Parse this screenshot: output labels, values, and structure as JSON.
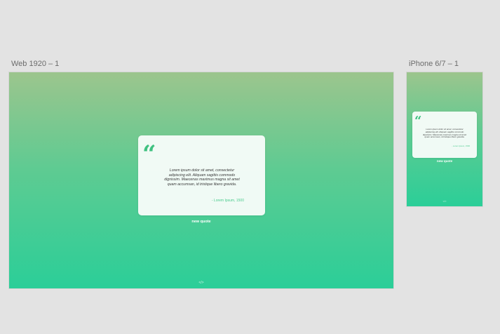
{
  "artboards": {
    "web": {
      "label": "Web 1920 – 1",
      "quote_mark": "“",
      "quote_text": "Lorem ipsum dolor sit amet, consectetur adipiscing elit. Aliquam sagittis commodo dignissim. Maecenas maximus magna sit amet quam accumsan, id tristique libero gravida.",
      "author": "- Lorem Ipsum, 1500",
      "button_label": "new quote",
      "footer_mark": "</>"
    },
    "iphone": {
      "label": "iPhone 6/7 – 1",
      "quote_mark": "“",
      "quote_text": "Lorem ipsum dolor sit amet, consectetur adipiscing elit. Aliquam sagittis commodo dignissim. Maecenas maximus magna sit amet quam accumsan, id tristique libero gravida.",
      "author": "- Lorem Ipsum, 1500",
      "button_label": "new quote",
      "footer_mark": "</>"
    }
  },
  "colors": {
    "canvas_bg": "#e3e3e3",
    "gradient_top": "#9cc58d",
    "gradient_bottom": "#2bce98",
    "accent": "#3fc180"
  }
}
